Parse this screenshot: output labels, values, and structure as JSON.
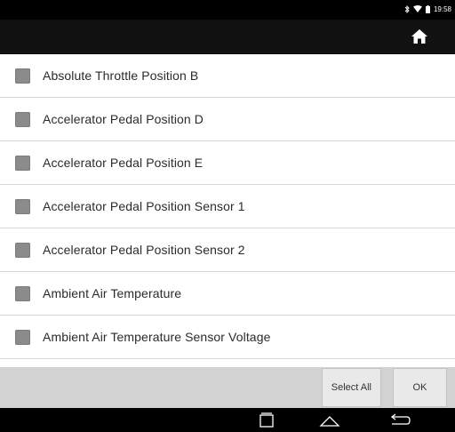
{
  "status_bar": {
    "time": "19:58",
    "icons": [
      "bluetooth-icon",
      "wifi-icon",
      "battery-icon"
    ]
  },
  "app_bar": {
    "home_icon": "home-icon"
  },
  "list": {
    "items": [
      {
        "label": "Absolute Throttle Position B",
        "checked": false
      },
      {
        "label": "Accelerator Pedal Position D",
        "checked": false
      },
      {
        "label": "Accelerator Pedal Position E",
        "checked": false
      },
      {
        "label": "Accelerator Pedal Position Sensor 1",
        "checked": false
      },
      {
        "label": "Accelerator Pedal Position Sensor 2",
        "checked": false
      },
      {
        "label": "Ambient Air Temperature",
        "checked": false
      },
      {
        "label": "Ambient Air Temperature Sensor Voltage",
        "checked": false
      }
    ]
  },
  "actions": {
    "select_all": "Select All",
    "ok": "OK"
  },
  "nav_bar": {
    "icons": [
      "recent-apps-icon",
      "home-nav-icon",
      "back-icon"
    ]
  },
  "colors": {
    "status_bar": "#000000",
    "app_bar": "#111111",
    "checkbox": "#8b8b8b",
    "action_bar": "#d2d2d2",
    "button": "#e9e9e9"
  }
}
